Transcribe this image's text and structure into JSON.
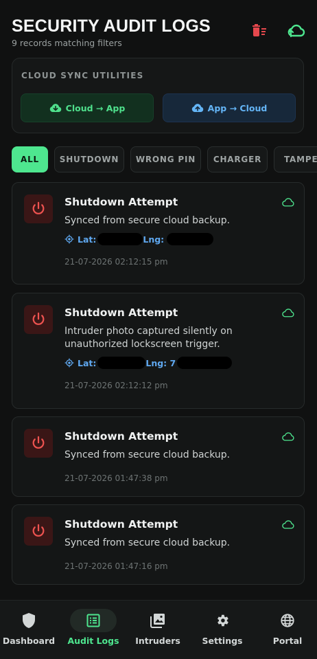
{
  "header": {
    "title": "SECURITY AUDIT LOGS",
    "subtitle": "9 records matching filters",
    "actions": [
      {
        "icon": "delete-sweep-icon",
        "color": "#e5484d"
      },
      {
        "icon": "cloud-sync-icon",
        "color": "#4ee68f"
      }
    ]
  },
  "sync": {
    "label": "CLOUD SYNC UTILITIES",
    "download_label": "Cloud → App",
    "upload_label": "App → Cloud"
  },
  "filters": [
    "ALL",
    "SHUTDOWN",
    "WRONG PIN",
    "CHARGER",
    "TAMPER"
  ],
  "logs": [
    {
      "title": "Shutdown Attempt",
      "description": "Synced from secure cloud backup.",
      "lat_label": "Lat:",
      "lng_label": "Lng:",
      "time": "21-07-2026 02:12:15 pm"
    },
    {
      "title": "Shutdown Attempt",
      "description": "Intruder photo captured silently on unauthorized lockscreen trigger.",
      "lat_label": "Lat:",
      "lng_label": "Lng: 7",
      "time": "21-07-2026 02:12:12 pm"
    },
    {
      "title": "Shutdown Attempt",
      "description": "Synced from secure cloud backup.",
      "time": "21-07-2026 01:47:38 pm"
    },
    {
      "title": "Shutdown Attempt",
      "description": "Synced from secure cloud backup.",
      "time": "21-07-2026 01:47:16 pm"
    }
  ],
  "nav": [
    {
      "label": "Dashboard",
      "icon": "shield-icon"
    },
    {
      "label": "Audit Logs",
      "icon": "list-icon",
      "active": true
    },
    {
      "label": "Intruders",
      "icon": "photo-library-icon"
    },
    {
      "label": "Settings",
      "icon": "gear-icon"
    },
    {
      "label": "Portal",
      "icon": "globe-icon"
    }
  ],
  "colors": {
    "accent": "#4ee68f",
    "danger": "#e5484d",
    "link": "#5fa8f0"
  }
}
